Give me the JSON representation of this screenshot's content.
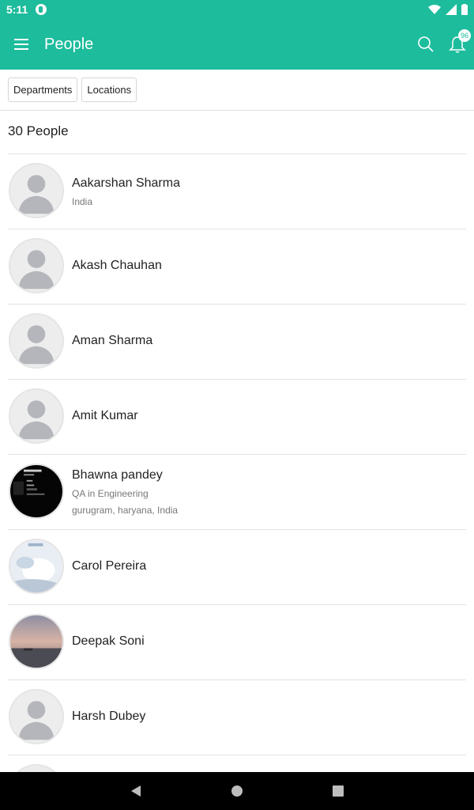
{
  "status": {
    "time": "5:11"
  },
  "appbar": {
    "title": "People",
    "notification_count": "96"
  },
  "filters": {
    "departments": "Departments",
    "locations": "Locations"
  },
  "people_count": "30 People",
  "people": [
    {
      "name": "Aakarshan Sharma",
      "line1": "India",
      "line2": "",
      "avatar": "placeholder"
    },
    {
      "name": "Akash Chauhan",
      "line1": "",
      "line2": "",
      "avatar": "placeholder"
    },
    {
      "name": "Aman Sharma",
      "line1": "",
      "line2": "",
      "avatar": "placeholder"
    },
    {
      "name": "Amit Kumar",
      "line1": "",
      "line2": "",
      "avatar": "placeholder"
    },
    {
      "name": "Bhawna pandey",
      "line1": "QA in Engineering",
      "line2": "gurugram, haryana, India",
      "avatar": "dark-photo"
    },
    {
      "name": "Carol Pereira",
      "line1": "",
      "line2": "",
      "avatar": "light-photo"
    },
    {
      "name": "Deepak Soni",
      "line1": "",
      "line2": "",
      "avatar": "sunset-photo"
    },
    {
      "name": "Harsh Dubey",
      "line1": "",
      "line2": "",
      "avatar": "placeholder"
    }
  ],
  "colors": {
    "accent": "#1dbc9c"
  }
}
